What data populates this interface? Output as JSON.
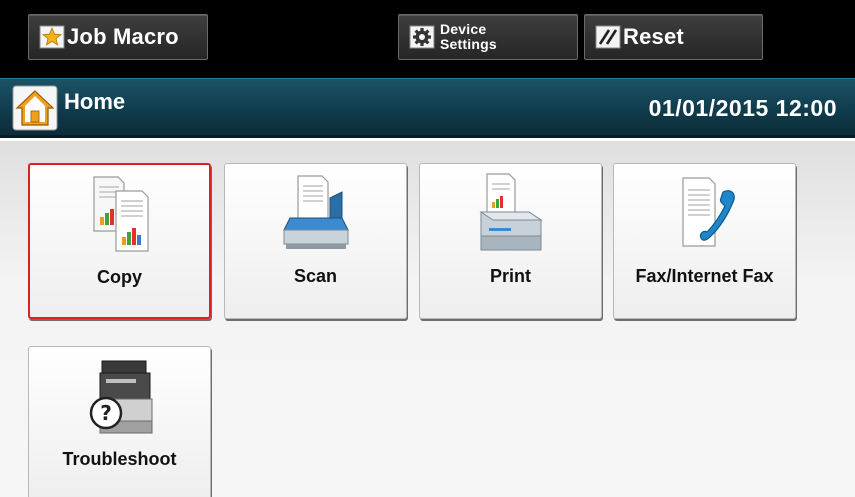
{
  "toolbar": {
    "job_macro_label": "Job Macro",
    "device_settings_label_line1": "Device",
    "device_settings_label_line2": "Settings",
    "reset_label": "Reset"
  },
  "header": {
    "title": "Home",
    "datetime": "01/01/2015 12:00"
  },
  "tiles": [
    {
      "label": "Copy",
      "icon": "copy-icon",
      "selected": true
    },
    {
      "label": "Scan",
      "icon": "scan-icon",
      "selected": false
    },
    {
      "label": "Print",
      "icon": "print-icon",
      "selected": false
    },
    {
      "label": "Fax/Internet Fax",
      "icon": "fax-icon",
      "selected": false
    },
    {
      "label": "Troubleshoot",
      "icon": "troubleshoot-icon",
      "selected": false
    }
  ],
  "colors": {
    "toolbar_bg": "#000000",
    "header_bg": "#103c4c",
    "selection_border": "#e02020",
    "content_bg": "#f4f4f4"
  }
}
